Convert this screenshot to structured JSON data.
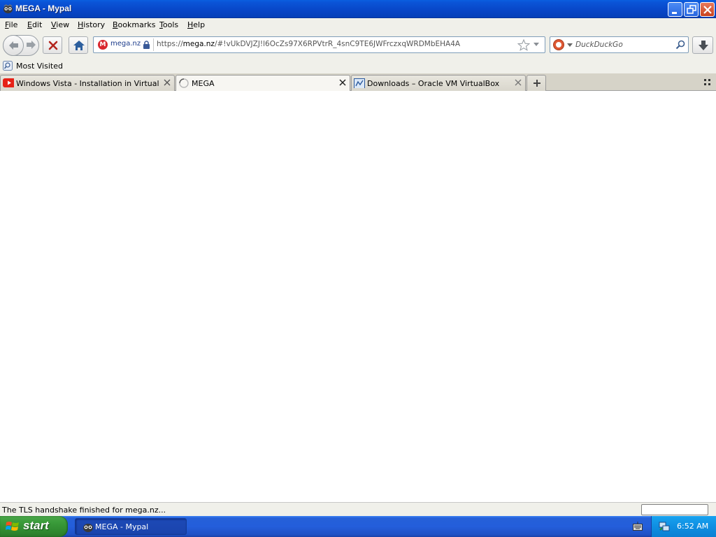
{
  "window": {
    "title": "MEGA - Mypal",
    "buttons": {
      "minimize": "minimize",
      "restore": "restore",
      "close": "close"
    }
  },
  "menubar": {
    "items": [
      {
        "label": "File",
        "accel": "F",
        "rest": "ile"
      },
      {
        "label": "Edit",
        "accel": "E",
        "rest": "dit"
      },
      {
        "label": "View",
        "accel": "V",
        "rest": "iew"
      },
      {
        "label": "History",
        "accel": "H",
        "rest": "istory"
      },
      {
        "label": "Bookmarks",
        "accel": "B",
        "rest": "ookmarks"
      },
      {
        "label": "Tools",
        "accel": "T",
        "rest": "ools"
      },
      {
        "label": "Help",
        "accel": "H",
        "rest": "elp"
      }
    ]
  },
  "navbar": {
    "identity_host": "mega.nz",
    "url_prefix": "https://",
    "url_domain": "mega.nz",
    "url_path": "/#!vUkDVJZJ!l6OcZs97X6RPVtrR_4snC9TE6JWFrczxqWRDMbEHA4A",
    "search_placeholder": "DuckDuckGo"
  },
  "bookmarks": {
    "items": [
      {
        "label": "Most Visited"
      }
    ]
  },
  "tabs": [
    {
      "label": "Windows Vista - Installation in Virtualbox ...",
      "active": false
    },
    {
      "label": "MEGA",
      "active": true
    },
    {
      "label": "Downloads – Oracle VM VirtualBox",
      "active": false
    }
  ],
  "status": {
    "text": "The TLS handshake finished for mega.nz..."
  },
  "taskbar": {
    "start_label": "start",
    "task_label": "MEGA - Mypal",
    "clock": "6:52 AM"
  },
  "colors": {
    "titlebar": "#0846c7",
    "accent_close": "#c7411e",
    "start_green": "#3a9b3a",
    "taskbar_blue": "#245edb",
    "tray_blue": "#0e8fe2"
  }
}
